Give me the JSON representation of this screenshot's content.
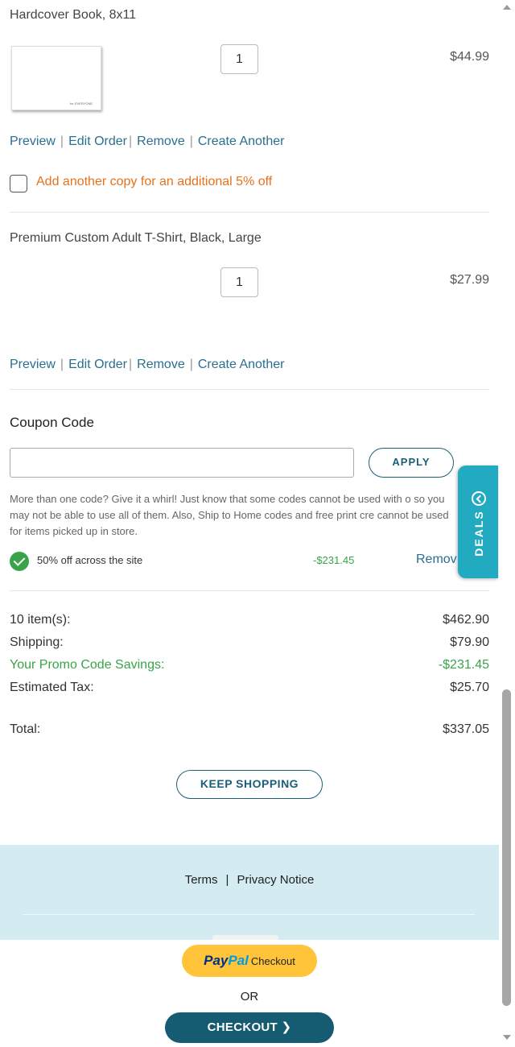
{
  "items": [
    {
      "title": "Hardcover Book, 8x11",
      "quantity": "1",
      "price": "$44.99",
      "thumbnail_caption": "for EVERYONE",
      "actions": {
        "preview": "Preview",
        "edit": "Edit Order",
        "remove": "Remove",
        "create": "Create Another"
      },
      "upsell": "Add another copy for an additional 5% off"
    },
    {
      "title": "Premium Custom Adult T-Shirt, Black, Large",
      "quantity": "1",
      "price": "$27.99",
      "actions": {
        "preview": "Preview",
        "edit": "Edit Order",
        "remove": "Remove",
        "create": "Create Another"
      }
    }
  ],
  "coupon": {
    "heading": "Coupon Code",
    "input_value": "",
    "apply_label": "APPLY",
    "help_text": "More than one code? Give it a whirl! Just know that some codes cannot be used with o so you may not be able to use all of them. Also, Ship to Home codes and free print cre cannot be used for items picked up in store.",
    "applied": {
      "label": "50% off across the site",
      "amount": "-$231.45",
      "remove_label": "Remov"
    }
  },
  "deals_tab": {
    "label": "DEALS",
    "icon": "chevron-left-circle-icon"
  },
  "summary": {
    "items": {
      "label": "10 item(s):",
      "value": "$462.90"
    },
    "shipping": {
      "label": "Shipping:",
      "value": "$79.90"
    },
    "promo": {
      "label": "Your Promo Code Savings:",
      "value": "-$231.45"
    },
    "tax": {
      "label": "Estimated Tax:",
      "value": "$25.70"
    },
    "total": {
      "label": "Total:",
      "value": "$337.05"
    }
  },
  "keep_shopping_label": "KEEP SHOPPING",
  "footer": {
    "terms": "Terms",
    "separator": "|",
    "privacy": "Privacy Notice"
  },
  "paypal": {
    "pay": "Pay",
    "pal": "Pal",
    "checkout": "Checkout"
  },
  "or_label": "OR",
  "checkout_label": "CHECKOUT ❯",
  "colors": {
    "accent": "#1a5f7a",
    "promo_green": "#3aa34a",
    "upsell_orange": "#e8711c",
    "deals_tab": "#22aac0",
    "footer_bg": "#d4ebf2",
    "paypal_yellow": "#ffc439"
  }
}
